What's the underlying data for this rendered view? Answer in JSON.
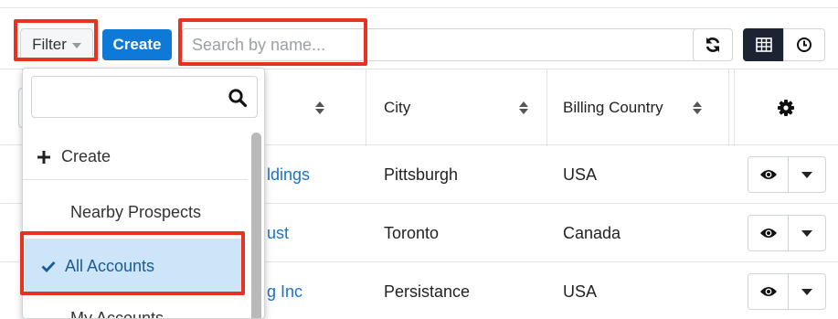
{
  "toolbar": {
    "filter_label": "Filter",
    "create_label": "Create",
    "search_placeholder": "Search by name..."
  },
  "table": {
    "columns": [
      "City",
      "Billing Country"
    ],
    "rows": [
      {
        "name": "ldings",
        "city": "Pittsburgh",
        "country": "USA"
      },
      {
        "name": "ust",
        "city": "Toronto",
        "country": "Canada"
      },
      {
        "name": "g Inc",
        "city": "Persistance",
        "country": "USA"
      }
    ]
  },
  "filter_menu": {
    "items": {
      "create": "Create",
      "nearby": "Nearby Prospects",
      "all": "All Accounts",
      "my": "My Accounts"
    },
    "selected": "All Accounts"
  },
  "colors": {
    "highlight": "#e8321f",
    "accent": "#0e79d7",
    "link": "#1a73c8",
    "selected_bg": "#cde5f8"
  },
  "icons": [
    "refresh-icon",
    "grid-view-icon",
    "clock-icon",
    "gear-icon",
    "eye-icon",
    "search-icon",
    "plus-icon",
    "check-icon"
  ]
}
